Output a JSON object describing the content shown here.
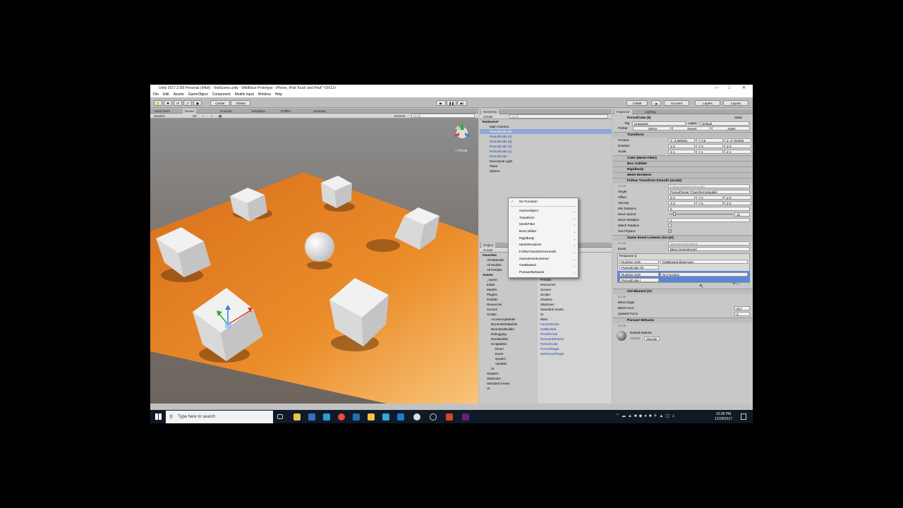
{
  "window": {
    "title": "Unity 2017.2.0f3 Personal (64bit) - TestScene.unity - WildRace-Prototype - iPhone, iPod Touch and iPad* <DX11>"
  },
  "menu": [
    "File",
    "Edit",
    "Assets",
    "GameObject",
    "Component",
    "Mobile Input",
    "Window",
    "Help"
  ],
  "toolbar": {
    "center": "Center",
    "global": "Global",
    "collab": "Collab",
    "account": "Account",
    "layers": "Layers",
    "layout": "Layout"
  },
  "scene_tabs": [
    "Asset Store",
    "Scene",
    "Console",
    "Animation",
    "Profiler",
    "Animator"
  ],
  "scene_sub": {
    "shaded": "Shaded",
    "mode2d": "2D",
    "gizmos": "Gizmos",
    "all": "QrAll",
    "persp": "< Persp"
  },
  "hierarchy": {
    "tab": "Hierarchy",
    "create": "Create",
    "search": "QrAll",
    "scene": "TestScene*",
    "items": [
      "Main Camera",
      "PursuitCube (5)",
      "PursuitCube (4)",
      "PursuitCube (3)",
      "PursuitCube (2)",
      "PursuitCube (1)",
      "PursuitCube",
      "Directional Light",
      "Plane",
      "Sphere"
    ]
  },
  "project": {
    "tab": "Project",
    "create": "Create",
    "assets_header": "Assets",
    "tree": [
      "Favorites",
      "All Materials",
      "All Models",
      "All Prefabs",
      "Assets",
      "_Game",
      "Editor",
      "Models",
      "Plugins",
      "Prefabs",
      "Resources",
      "Scenes",
      "Scripts",
      "AccessoryBuilder",
      "BezierMeshBuilder",
      "BoundaryBuilder",
      "Debugging",
      "RaceBuilder",
      "Scriptables",
      "Enum",
      "Event",
      "System",
      "Variable",
      "UI",
      "Shaders",
      "Skyboxes",
      "Standard Assets",
      "UI"
    ],
    "files": [
      "_Game",
      "Editor",
      "Models",
      "Plugins",
      "Prefabs",
      "Resources",
      "Scenes",
      "Scripts",
      "Shaders",
      "Skyboxes",
      "Standard Assets",
      "UI",
      "Blast",
      "ForestTerrain",
      "GetBlasted",
      "PondTerrain",
      "PursuerBehavior",
      "PursuitCube",
      "PursuitTarget",
      "SetPursuitTarget"
    ]
  },
  "inspector": {
    "tab": "Inspector",
    "lighting": "Lighting",
    "name": "PursuitCube (5)",
    "static": "Static",
    "tag_label": "Tag",
    "tag": "Untagged",
    "layer_label": "Layer",
    "layer": "Default",
    "prefab": "Prefab",
    "select": "Select",
    "revert": "Revert",
    "apply": "Apply",
    "transform": "Transform",
    "position": "Position",
    "rotation": "Rotation",
    "scale": "Scale",
    "pos": [
      "X -3.690281",
      "Y 0.5",
      "Z -0.702066"
    ],
    "rot": [
      "X 0",
      "Y 0",
      "Z 0"
    ],
    "scl": [
      "X 1",
      "Y 1",
      "Z 1"
    ],
    "cube_filter": "Cube (Mesh Filter)",
    "box_collider": "Box Collider",
    "rigidbody": "Rigidbody",
    "mesh_renderer": "Mesh Renderer",
    "follow": "Follow Transform Smooth (Script)",
    "script": "Script",
    "follow_script": "FollowTransformSmooth",
    "target": "Target",
    "target_val": "PursuitTarget (TransformVariable)",
    "offset": "Offset",
    "velocity": "Velocity",
    "vec0": [
      "X 0",
      "Y 0",
      "Z 0"
    ],
    "min_distance": "Min Distance",
    "min_val": "0",
    "move_speed": "Move Speed",
    "speed_val": "10",
    "move_mult": "Move Multiplier",
    "mult_val": "1",
    "match_rot": "Match Rotation",
    "use_physics": "Use Physics",
    "gel": "Game Event Listener (Script)",
    "gel_script": "GameEventListener",
    "event": "Event",
    "event_val": "Blast (GameEvent)",
    "response": "Response ()",
    "runtime": "Runtime Only",
    "func1": "GetBlasted.BlastAway",
    "obj1": "PursuitCube (5)",
    "runtime2": "Runtime Only",
    "nofunc": "No Function",
    "obj2": "PursuitCube (",
    "getblasted": "Get Blasted (Sc",
    "blast_origin": "Blast Origin",
    "blast_force": "Blast Force",
    "upward": "Upward Force",
    "force_val": "217",
    "up_val": "0",
    "pursuer": "Pursuer Behavio",
    "material": "Default-Materia",
    "shader": "Shader",
    "standard": "Standar"
  },
  "dropdown": {
    "items": [
      "No Function",
      "GameObject",
      "Transform",
      "MeshFilter",
      "BoxCollider",
      "Rigidbody",
      "MeshRenderer",
      "FollowTransformSmooth",
      "GameEventListener",
      "GetBlasted",
      "PursuerBehavior"
    ]
  },
  "taskbar": {
    "search": "Type here to search",
    "time": "10:38 PM",
    "date": "12/28/2017"
  }
}
